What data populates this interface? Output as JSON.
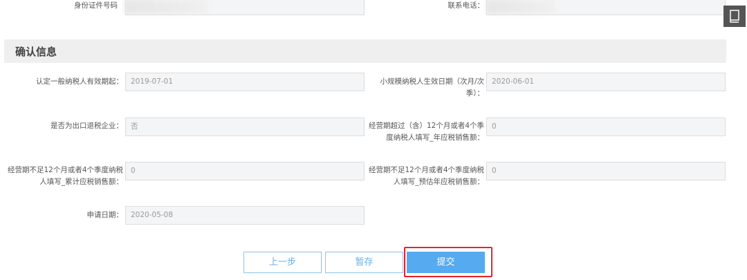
{
  "top_fields": {
    "id_label": "身份证件号码",
    "phone_label": "联系电话："
  },
  "section": {
    "title": "确认信息"
  },
  "fields": {
    "general_start_label": "认定一般纳税人有效期起：",
    "general_start_value": "2019-07-01",
    "small_effective_label": "小规模纳税人生效日期（次月/次季）：",
    "small_effective_value": "2020-06-01",
    "export_label": "是否为出口退税企业：",
    "export_value": "否",
    "over12_label": "经营期超过（含）12个月或者4个季度纳税人填写_年应税销售额：",
    "over12_value": "0",
    "under12_cum_label": "经营期不足12个月或者4个季度纳税人填写_累计应税销售额：",
    "under12_cum_value": "0",
    "under12_est_label": "经营期不足12个月或者4个季度纳税人填写_预估年应税销售额：",
    "under12_est_value": "0",
    "apply_date_label": "申请日期：",
    "apply_date_value": "2020-05-08"
  },
  "buttons": {
    "prev": "上一步",
    "save": "暂存",
    "submit": "提交"
  },
  "icons": {
    "side": "book-icon"
  },
  "colors": {
    "primary": "#56aaf0",
    "highlight": "#e8232a"
  }
}
